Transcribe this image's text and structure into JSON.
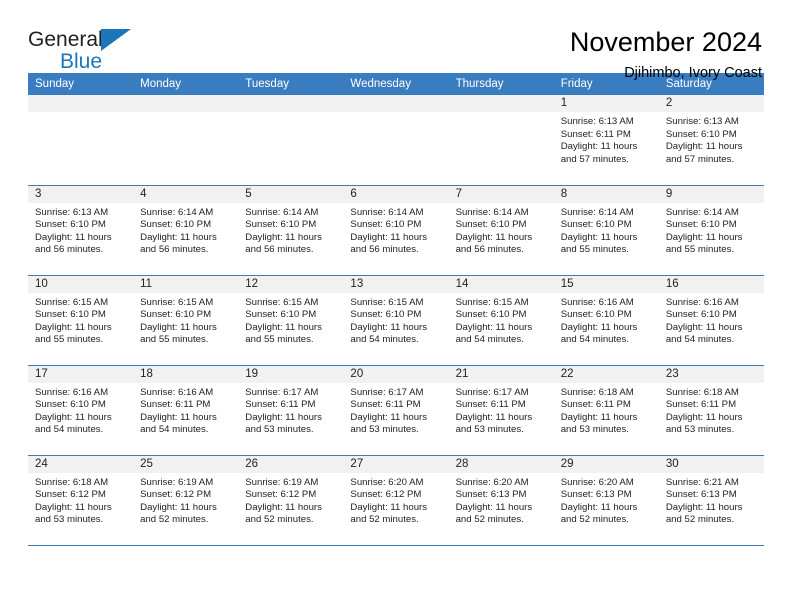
{
  "brand": {
    "name_part1": "General",
    "name_part2": "Blue",
    "logo_icon": "triangle-logo-icon",
    "accent_color": "#1b76bc"
  },
  "header": {
    "title": "November 2024",
    "location": "Djihimbo, Ivory Coast"
  },
  "calendar": {
    "header_bg": "#3a7cc0",
    "daynum_bg": "#f1f1f1",
    "weekday_headers": [
      "Sunday",
      "Monday",
      "Tuesday",
      "Wednesday",
      "Thursday",
      "Friday",
      "Saturday"
    ],
    "weeks": [
      [
        {
          "day": "",
          "sunrise": "",
          "sunset": "",
          "daylight_line1": "",
          "daylight_line2": ""
        },
        {
          "day": "",
          "sunrise": "",
          "sunset": "",
          "daylight_line1": "",
          "daylight_line2": ""
        },
        {
          "day": "",
          "sunrise": "",
          "sunset": "",
          "daylight_line1": "",
          "daylight_line2": ""
        },
        {
          "day": "",
          "sunrise": "",
          "sunset": "",
          "daylight_line1": "",
          "daylight_line2": ""
        },
        {
          "day": "",
          "sunrise": "",
          "sunset": "",
          "daylight_line1": "",
          "daylight_line2": ""
        },
        {
          "day": "1",
          "sunrise": "Sunrise: 6:13 AM",
          "sunset": "Sunset: 6:11 PM",
          "daylight_line1": "Daylight: 11 hours",
          "daylight_line2": "and 57 minutes."
        },
        {
          "day": "2",
          "sunrise": "Sunrise: 6:13 AM",
          "sunset": "Sunset: 6:10 PM",
          "daylight_line1": "Daylight: 11 hours",
          "daylight_line2": "and 57 minutes."
        }
      ],
      [
        {
          "day": "3",
          "sunrise": "Sunrise: 6:13 AM",
          "sunset": "Sunset: 6:10 PM",
          "daylight_line1": "Daylight: 11 hours",
          "daylight_line2": "and 56 minutes."
        },
        {
          "day": "4",
          "sunrise": "Sunrise: 6:14 AM",
          "sunset": "Sunset: 6:10 PM",
          "daylight_line1": "Daylight: 11 hours",
          "daylight_line2": "and 56 minutes."
        },
        {
          "day": "5",
          "sunrise": "Sunrise: 6:14 AM",
          "sunset": "Sunset: 6:10 PM",
          "daylight_line1": "Daylight: 11 hours",
          "daylight_line2": "and 56 minutes."
        },
        {
          "day": "6",
          "sunrise": "Sunrise: 6:14 AM",
          "sunset": "Sunset: 6:10 PM",
          "daylight_line1": "Daylight: 11 hours",
          "daylight_line2": "and 56 minutes."
        },
        {
          "day": "7",
          "sunrise": "Sunrise: 6:14 AM",
          "sunset": "Sunset: 6:10 PM",
          "daylight_line1": "Daylight: 11 hours",
          "daylight_line2": "and 56 minutes."
        },
        {
          "day": "8",
          "sunrise": "Sunrise: 6:14 AM",
          "sunset": "Sunset: 6:10 PM",
          "daylight_line1": "Daylight: 11 hours",
          "daylight_line2": "and 55 minutes."
        },
        {
          "day": "9",
          "sunrise": "Sunrise: 6:14 AM",
          "sunset": "Sunset: 6:10 PM",
          "daylight_line1": "Daylight: 11 hours",
          "daylight_line2": "and 55 minutes."
        }
      ],
      [
        {
          "day": "10",
          "sunrise": "Sunrise: 6:15 AM",
          "sunset": "Sunset: 6:10 PM",
          "daylight_line1": "Daylight: 11 hours",
          "daylight_line2": "and 55 minutes."
        },
        {
          "day": "11",
          "sunrise": "Sunrise: 6:15 AM",
          "sunset": "Sunset: 6:10 PM",
          "daylight_line1": "Daylight: 11 hours",
          "daylight_line2": "and 55 minutes."
        },
        {
          "day": "12",
          "sunrise": "Sunrise: 6:15 AM",
          "sunset": "Sunset: 6:10 PM",
          "daylight_line1": "Daylight: 11 hours",
          "daylight_line2": "and 55 minutes."
        },
        {
          "day": "13",
          "sunrise": "Sunrise: 6:15 AM",
          "sunset": "Sunset: 6:10 PM",
          "daylight_line1": "Daylight: 11 hours",
          "daylight_line2": "and 54 minutes."
        },
        {
          "day": "14",
          "sunrise": "Sunrise: 6:15 AM",
          "sunset": "Sunset: 6:10 PM",
          "daylight_line1": "Daylight: 11 hours",
          "daylight_line2": "and 54 minutes."
        },
        {
          "day": "15",
          "sunrise": "Sunrise: 6:16 AM",
          "sunset": "Sunset: 6:10 PM",
          "daylight_line1": "Daylight: 11 hours",
          "daylight_line2": "and 54 minutes."
        },
        {
          "day": "16",
          "sunrise": "Sunrise: 6:16 AM",
          "sunset": "Sunset: 6:10 PM",
          "daylight_line1": "Daylight: 11 hours",
          "daylight_line2": "and 54 minutes."
        }
      ],
      [
        {
          "day": "17",
          "sunrise": "Sunrise: 6:16 AM",
          "sunset": "Sunset: 6:10 PM",
          "daylight_line1": "Daylight: 11 hours",
          "daylight_line2": "and 54 minutes."
        },
        {
          "day": "18",
          "sunrise": "Sunrise: 6:16 AM",
          "sunset": "Sunset: 6:11 PM",
          "daylight_line1": "Daylight: 11 hours",
          "daylight_line2": "and 54 minutes."
        },
        {
          "day": "19",
          "sunrise": "Sunrise: 6:17 AM",
          "sunset": "Sunset: 6:11 PM",
          "daylight_line1": "Daylight: 11 hours",
          "daylight_line2": "and 53 minutes."
        },
        {
          "day": "20",
          "sunrise": "Sunrise: 6:17 AM",
          "sunset": "Sunset: 6:11 PM",
          "daylight_line1": "Daylight: 11 hours",
          "daylight_line2": "and 53 minutes."
        },
        {
          "day": "21",
          "sunrise": "Sunrise: 6:17 AM",
          "sunset": "Sunset: 6:11 PM",
          "daylight_line1": "Daylight: 11 hours",
          "daylight_line2": "and 53 minutes."
        },
        {
          "day": "22",
          "sunrise": "Sunrise: 6:18 AM",
          "sunset": "Sunset: 6:11 PM",
          "daylight_line1": "Daylight: 11 hours",
          "daylight_line2": "and 53 minutes."
        },
        {
          "day": "23",
          "sunrise": "Sunrise: 6:18 AM",
          "sunset": "Sunset: 6:11 PM",
          "daylight_line1": "Daylight: 11 hours",
          "daylight_line2": "and 53 minutes."
        }
      ],
      [
        {
          "day": "24",
          "sunrise": "Sunrise: 6:18 AM",
          "sunset": "Sunset: 6:12 PM",
          "daylight_line1": "Daylight: 11 hours",
          "daylight_line2": "and 53 minutes."
        },
        {
          "day": "25",
          "sunrise": "Sunrise: 6:19 AM",
          "sunset": "Sunset: 6:12 PM",
          "daylight_line1": "Daylight: 11 hours",
          "daylight_line2": "and 52 minutes."
        },
        {
          "day": "26",
          "sunrise": "Sunrise: 6:19 AM",
          "sunset": "Sunset: 6:12 PM",
          "daylight_line1": "Daylight: 11 hours",
          "daylight_line2": "and 52 minutes."
        },
        {
          "day": "27",
          "sunrise": "Sunrise: 6:20 AM",
          "sunset": "Sunset: 6:12 PM",
          "daylight_line1": "Daylight: 11 hours",
          "daylight_line2": "and 52 minutes."
        },
        {
          "day": "28",
          "sunrise": "Sunrise: 6:20 AM",
          "sunset": "Sunset: 6:13 PM",
          "daylight_line1": "Daylight: 11 hours",
          "daylight_line2": "and 52 minutes."
        },
        {
          "day": "29",
          "sunrise": "Sunrise: 6:20 AM",
          "sunset": "Sunset: 6:13 PM",
          "daylight_line1": "Daylight: 11 hours",
          "daylight_line2": "and 52 minutes."
        },
        {
          "day": "30",
          "sunrise": "Sunrise: 6:21 AM",
          "sunset": "Sunset: 6:13 PM",
          "daylight_line1": "Daylight: 11 hours",
          "daylight_line2": "and 52 minutes."
        }
      ]
    ]
  }
}
